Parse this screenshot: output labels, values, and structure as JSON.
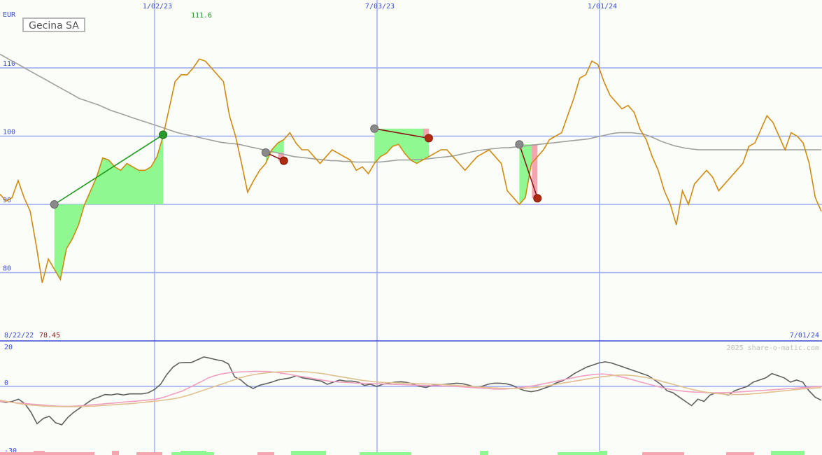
{
  "chart_data": {
    "type": "line",
    "title": "Gecina SA",
    "currency": "EUR",
    "date_range": {
      "start": "8/22/22",
      "end": "7/01/24"
    },
    "x_ticks": [
      "1/02/23",
      "7/03/23",
      "1/01/24"
    ],
    "y_ticks": [
      80,
      90,
      100,
      110
    ],
    "ylim": [
      73,
      119
    ],
    "max_label": "111.6",
    "min_label": "78.45",
    "credit": "2025 share-o-matic.com",
    "grid": true,
    "series": [
      {
        "values": [
          91.5,
          90.5,
          91,
          93.5,
          91,
          89,
          84,
          78.5,
          82,
          80.5,
          79,
          83.5,
          85,
          87,
          90,
          92,
          94,
          96.8,
          96.5,
          95.5,
          95,
          96,
          95.5,
          95,
          95,
          95.5,
          97,
          100,
          104,
          108,
          109,
          109,
          110,
          111.3,
          111,
          110,
          109,
          108,
          103,
          100,
          96,
          91.8,
          93.5,
          95,
          96,
          98,
          99,
          99.5,
          100.5,
          99,
          98,
          98,
          97,
          96,
          97,
          98,
          97.5,
          97,
          96.5,
          95,
          95.5,
          94.5,
          96,
          97,
          97.5,
          98.5,
          98.8,
          97.5,
          96.5,
          96,
          96.5,
          97,
          97.5,
          98,
          98,
          97,
          96,
          95,
          96,
          97,
          97.5,
          98,
          97,
          96,
          92,
          91,
          90,
          91,
          96,
          97,
          98,
          99.5,
          100,
          100.5,
          103,
          105.5,
          108.5,
          109,
          111,
          110.5,
          108,
          106,
          105,
          104,
          104.5,
          103.5,
          101,
          99.5,
          97,
          95,
          92,
          90,
          87,
          92,
          90,
          93,
          94,
          95,
          94,
          92,
          93,
          94,
          95,
          96,
          98.5,
          99,
          101,
          103,
          102,
          100,
          98,
          100.5,
          100,
          99,
          96,
          91,
          89
        ]
      },
      {
        "values": [
          112,
          111.5,
          111,
          110.5,
          110,
          109.5,
          109,
          108.5,
          108,
          107.5,
          107,
          106.5,
          106,
          105.5,
          105.2,
          104.9,
          104.6,
          104.2,
          103.8,
          103.5,
          103.2,
          102.9,
          102.6,
          102.3,
          102,
          101.7,
          101.4,
          101.1,
          100.8,
          100.5,
          100.3,
          100.1,
          99.9,
          99.7,
          99.5,
          99.3,
          99.1,
          99,
          98.9,
          98.8,
          98.6,
          98.4,
          98.2,
          98,
          97.8,
          97.6,
          97.4,
          97.2,
          97,
          96.9,
          96.8,
          96.7,
          96.6,
          96.5,
          96.4,
          96.4,
          96.3,
          96.3,
          96.2,
          96.2,
          96.2,
          96.2,
          96.2,
          96.3,
          96.4,
          96.5,
          96.5,
          96.5,
          96.6,
          96.6,
          96.7,
          96.8,
          96.9,
          97,
          97.1,
          97.3,
          97.5,
          97.7,
          97.9,
          98,
          98.1,
          98.2,
          98.3,
          98.3,
          98.4,
          98.5,
          98.6,
          98.7,
          98.8,
          98.9,
          99,
          99.1,
          99.2,
          99.3,
          99.4,
          99.5,
          99.6,
          99.8,
          100,
          100.2,
          100.4,
          100.5,
          100.5,
          100.5,
          100.4,
          100.3,
          100,
          99.6,
          99.2,
          98.9,
          98.6,
          98.4,
          98.2,
          98.1,
          98,
          98,
          98,
          98,
          98,
          98,
          98,
          98,
          98,
          98,
          98,
          98,
          98,
          98,
          98,
          98,
          98,
          98,
          98,
          98,
          98
        ]
      },
      {
        "values": [
          -7,
          -7.5,
          -7,
          -6,
          -8,
          -12,
          -17.5,
          -15,
          -14,
          -17,
          -18,
          -14.5,
          -12,
          -10,
          -8,
          -6,
          -5,
          -3.8,
          -4,
          -3.5,
          -4,
          -3.5,
          -3.5,
          -3.5,
          -3,
          -1.5,
          1,
          5.5,
          9,
          11,
          11.2,
          11.2,
          12.5,
          13.8,
          13.2,
          12.5,
          12,
          10.5,
          4.5,
          3,
          0.5,
          -1,
          0.5,
          1.2,
          2,
          3,
          3.5,
          4,
          5,
          4,
          3.5,
          3,
          2.5,
          1,
          2,
          3,
          2.5,
          2.5,
          2,
          0.5,
          1,
          0,
          1,
          1.5,
          2,
          2.2,
          1.8,
          1,
          0,
          -0.5,
          0.5,
          0.8,
          1,
          1.2,
          1.5,
          1.2,
          0.5,
          -0.5,
          0,
          1,
          1.5,
          1.5,
          1.2,
          0.5,
          -1,
          -2,
          -2.5,
          -2,
          -1,
          0,
          1.5,
          2.5,
          4,
          6,
          7.5,
          9,
          10,
          11,
          11.5,
          11,
          10,
          9,
          8,
          7,
          6,
          5,
          3,
          1,
          -2,
          -3,
          -5,
          -7,
          -9,
          -6,
          -7,
          -4,
          -3,
          -3.5,
          -4,
          -2,
          -1,
          0,
          2,
          3,
          4,
          6,
          5,
          4,
          2,
          3,
          2,
          -2,
          -5,
          -6.5
        ]
      },
      {
        "values": [
          -7,
          -7.2,
          -7.5,
          -7.8,
          -8,
          -8.3,
          -8.5,
          -8.8,
          -9,
          -9.2,
          -9.3,
          -9.3,
          -9.2,
          -9,
          -8.8,
          -8.5,
          -8.3,
          -8,
          -7.8,
          -7.5,
          -7.2,
          -7,
          -6.8,
          -6.5,
          -6.2,
          -5.8,
          -5,
          -4,
          -3,
          -2,
          -0.5,
          1,
          2.5,
          4,
          5,
          5.8,
          6.3,
          6.6,
          6.8,
          6.9,
          7,
          7,
          7,
          6.8,
          6.5,
          6,
          5.5,
          5,
          4.5,
          4,
          3.5,
          3,
          2.5,
          2.2,
          2,
          1.8,
          1.6,
          1.5,
          1.4,
          1.3,
          1.2,
          1.1,
          1,
          0.9,
          0.8,
          0.7,
          0.6,
          0.5,
          0.4,
          0.3,
          0.2,
          0.1,
          0,
          -0.2,
          -0.4,
          -0.6,
          -0.8,
          -1,
          -1.2,
          -1.3,
          -1.2,
          -1,
          -0.7,
          -0.3,
          0.1,
          0.6,
          1.2,
          1.8,
          2.4,
          3,
          3.6,
          4.2,
          4.8,
          5.2,
          5.6,
          5.8,
          5.7,
          5.3,
          4.7,
          4,
          3.2,
          2.4,
          1.6,
          0.8,
          0,
          -0.7,
          -1.3,
          -1.8,
          -2.2,
          -2.5,
          -2.7,
          -2.8,
          -2.9,
          -3,
          -3,
          -2.9,
          -2.8,
          -2.6,
          -2.4,
          -2.2,
          -2,
          -1.8,
          -1.6,
          -1.4,
          -1.2,
          -1,
          -0.8,
          -0.6,
          -0.4,
          -0.2,
          0
        ]
      },
      {
        "values": [
          -6.5,
          -7,
          -7.5,
          -8,
          -8.5,
          -8.8,
          -9,
          -9.2,
          -9.3,
          -9.4,
          -9.5,
          -9.5,
          -9.5,
          -9.4,
          -9.3,
          -9.2,
          -9,
          -8.8,
          -8.6,
          -8.4,
          -8.2,
          -8,
          -7.7,
          -7.4,
          -7.1,
          -6.8,
          -6.4,
          -6,
          -5.5,
          -4.8,
          -4,
          -3,
          -2,
          -1,
          0,
          1,
          2,
          3,
          4,
          4.8,
          5.4,
          5.9,
          6.3,
          6.6,
          6.8,
          6.9,
          7,
          7,
          6.9,
          6.7,
          6.4,
          6,
          5.5,
          5,
          4.5,
          4,
          3.5,
          3,
          2.6,
          2.3,
          2,
          1.8,
          1.7,
          1.6,
          1.5,
          1.4,
          1.3,
          1.2,
          1.1,
          1,
          0.9,
          0.7,
          0.5,
          0.3,
          0.1,
          -0.1,
          -0.3,
          -0.5,
          -0.7,
          -0.8,
          -0.9,
          -1,
          -1,
          -0.9,
          -0.7,
          -0.4,
          0,
          0.5,
          1,
          1.5,
          2,
          2.5,
          3,
          3.5,
          4,
          4.4,
          4.8,
          5.1,
          5.3,
          5.3,
          5.1,
          4.8,
          4.3,
          3.7,
          3,
          2.2,
          1.4,
          0.6,
          -0.2,
          -1,
          -1.7,
          -2.3,
          -2.8,
          -3.2,
          -3.5,
          -3.7,
          -3.8,
          -3.8,
          -3.7,
          -3.5,
          -3.3,
          -3,
          -2.7,
          -2.4,
          -2.1,
          -1.8,
          -1.5,
          -1.2,
          -1,
          -0.8,
          -0.6
        ]
      }
    ],
    "trades": [
      {
        "entry_idx": 9,
        "exit_idx": 27,
        "entry": 90,
        "exit": 100.2,
        "result": "win"
      },
      {
        "entry_idx": 44,
        "exit_idx": 47,
        "entry": 97.6,
        "exit": 96.4,
        "result": "loss"
      },
      {
        "entry_idx": 62,
        "exit_idx": 71,
        "entry": 101.1,
        "exit": 99.7,
        "result": "loss"
      },
      {
        "entry_idx": 86,
        "exit_idx": 89,
        "entry": 98.8,
        "exit": 90.9,
        "result": "loss"
      }
    ],
    "oscillator": {
      "y_ticks": [
        20,
        0,
        -30
      ],
      "ylim": [
        -30,
        20
      ]
    }
  }
}
